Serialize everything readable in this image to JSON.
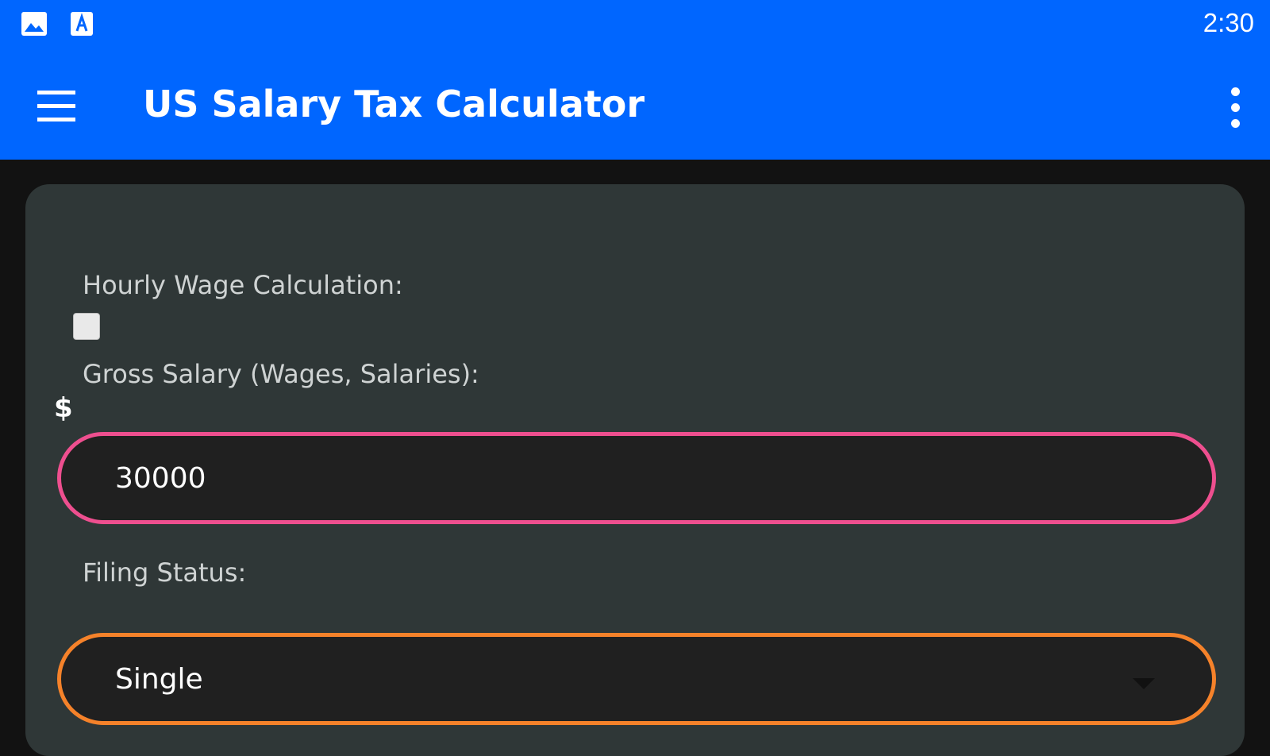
{
  "statusbar": {
    "time": "2:30",
    "icons": [
      "image-notification-icon",
      "font-notification-icon"
    ]
  },
  "appbar": {
    "title": "US Salary Tax Calculator",
    "menu_icon": "hamburger-menu-icon",
    "more_icon": "more-vert-icon"
  },
  "form": {
    "hourly_label": "Hourly Wage Calculation:",
    "hourly_checked": false,
    "gross_label": "Gross Salary (Wages, Salaries):",
    "currency_symbol": "$",
    "gross_value": "30000",
    "filing_label": "Filing Status:",
    "filing_value": "Single"
  },
  "colors": {
    "primary": "#0066ff",
    "background": "#121212",
    "card": "#2f3737",
    "salary_border": "#ee4f8f",
    "filing_border": "#f5822a"
  }
}
